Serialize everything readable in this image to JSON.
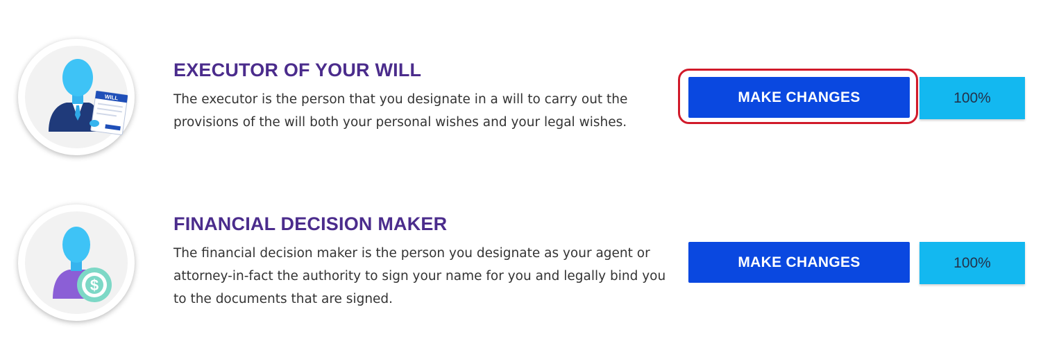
{
  "sections": [
    {
      "icon": "executor-will-icon",
      "icon_caption": "WILL",
      "title": "EXECUTOR OF YOUR WILL",
      "description": "The executor is the person that you designate in a will to carry out the provisions of the will both your personal wishes and your legal wishes.",
      "button_label": "MAKE CHANGES",
      "progress": "100%"
    },
    {
      "icon": "financial-decision-maker-icon",
      "title": "FINANCIAL DECISION MAKER",
      "description": "The financial decision maker is the person you designate as your agent or attorney-in-fact the authority to sign your name for you and legally bind you to the documents that are signed.",
      "button_label": "MAKE CHANGES",
      "progress": "100%"
    }
  ],
  "colors": {
    "title": "#4b2c8c",
    "button": "#0a48e0",
    "progress": "#13b8f0",
    "highlight": "#d11a2a",
    "avatar": "#3ec3f6"
  }
}
